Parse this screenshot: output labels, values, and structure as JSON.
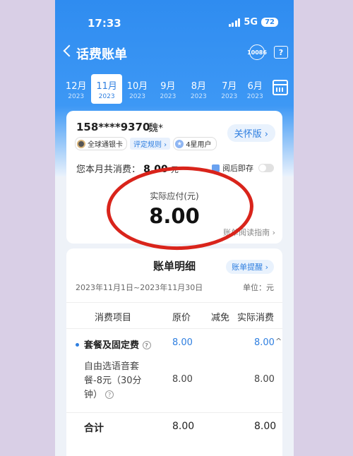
{
  "status": {
    "time": "17:33",
    "network": "5G",
    "battery": "72"
  },
  "nav": {
    "title": "话费账单",
    "service_icon": "10086",
    "help_icon": "?"
  },
  "months": [
    {
      "month": "12月",
      "year": "2023"
    },
    {
      "month": "11月",
      "year": "2023",
      "active": true
    },
    {
      "month": "10月",
      "year": "2023"
    },
    {
      "month": "9月",
      "year": "2023"
    },
    {
      "month": "8月",
      "year": "2023"
    },
    {
      "month": "7月",
      "year": "2023"
    },
    {
      "month": "6月",
      "year": "2023"
    }
  ],
  "account": {
    "phone": "158****9370",
    "name": "魏*",
    "care_button": "关怀版 ›",
    "card_badge": "全球通银卡",
    "rule_badge": "评定规则 ›",
    "star_badge": "4星用户",
    "consume_label": "您本月共消费：",
    "consume_amount": "8.00",
    "consume_unit": "元",
    "save_label": "阅后即存",
    "pay_label": "实际应付(元)",
    "pay_amount": "8.00",
    "guide_link": "账单阅读指南 ›"
  },
  "detail": {
    "title": "账单明细",
    "remind_button": "账单提醒 ›",
    "period": "2023年11月1日~2023年11月30日",
    "unit": "单位：元",
    "columns": [
      "消费项目",
      "原价",
      "减免",
      "实际消费"
    ],
    "package_row": {
      "name": "套餐及固定费",
      "price": "8.00",
      "actual": "8.00"
    },
    "sub_row": {
      "name_line1": "自由选语音套",
      "name_line2": "餐-8元（30分",
      "name_line3": "钟）",
      "price": "8.00",
      "actual": "8.00"
    },
    "total_row": {
      "name": "合计",
      "price": "8.00",
      "actual": "8.00"
    }
  },
  "colors": {
    "brand_blue": "#2f8cf0",
    "annotation_red": "#d9241b",
    "background": "#d9cfe6"
  }
}
